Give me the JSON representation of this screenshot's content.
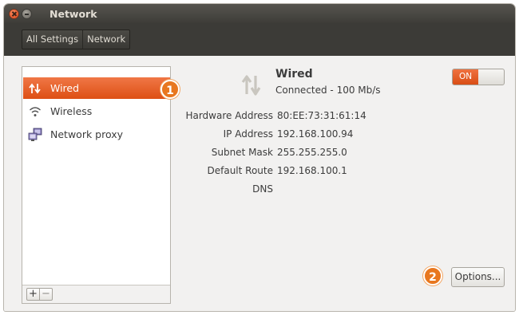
{
  "window": {
    "title": "Network",
    "close_icon": "close-icon",
    "minimize_icon": "minimize-icon"
  },
  "toolbar": {
    "breadcrumbs": [
      "All Settings",
      "Network"
    ]
  },
  "sidebar": {
    "items": [
      {
        "label": "Wired",
        "icon": "wired-icon",
        "selected": true
      },
      {
        "label": "Wireless",
        "icon": "wireless-icon",
        "selected": false
      },
      {
        "label": "Network proxy",
        "icon": "network-proxy-icon",
        "selected": false
      }
    ],
    "add_label": "+",
    "remove_label": "−"
  },
  "annotations": {
    "badge1": "1",
    "badge2": "2",
    "color": "#e8771f"
  },
  "device": {
    "name": "Wired",
    "status": "Connected - 100 Mb/s",
    "toggle_label": "ON",
    "toggle_on": true
  },
  "details": [
    {
      "label": "Hardware Address",
      "value": "80:EE:73:31:61:14"
    },
    {
      "label": "IP Address",
      "value": "192.168.100.94"
    },
    {
      "label": "Subnet Mask",
      "value": "255.255.255.0"
    },
    {
      "label": "Default Route",
      "value": "192.168.100.1"
    },
    {
      "label": "DNS",
      "value": ""
    }
  ],
  "options_label": "Options...",
  "colors": {
    "accent": "#dd4f14",
    "titlebar": "#3c3b37",
    "background": "#f2f1f0"
  }
}
